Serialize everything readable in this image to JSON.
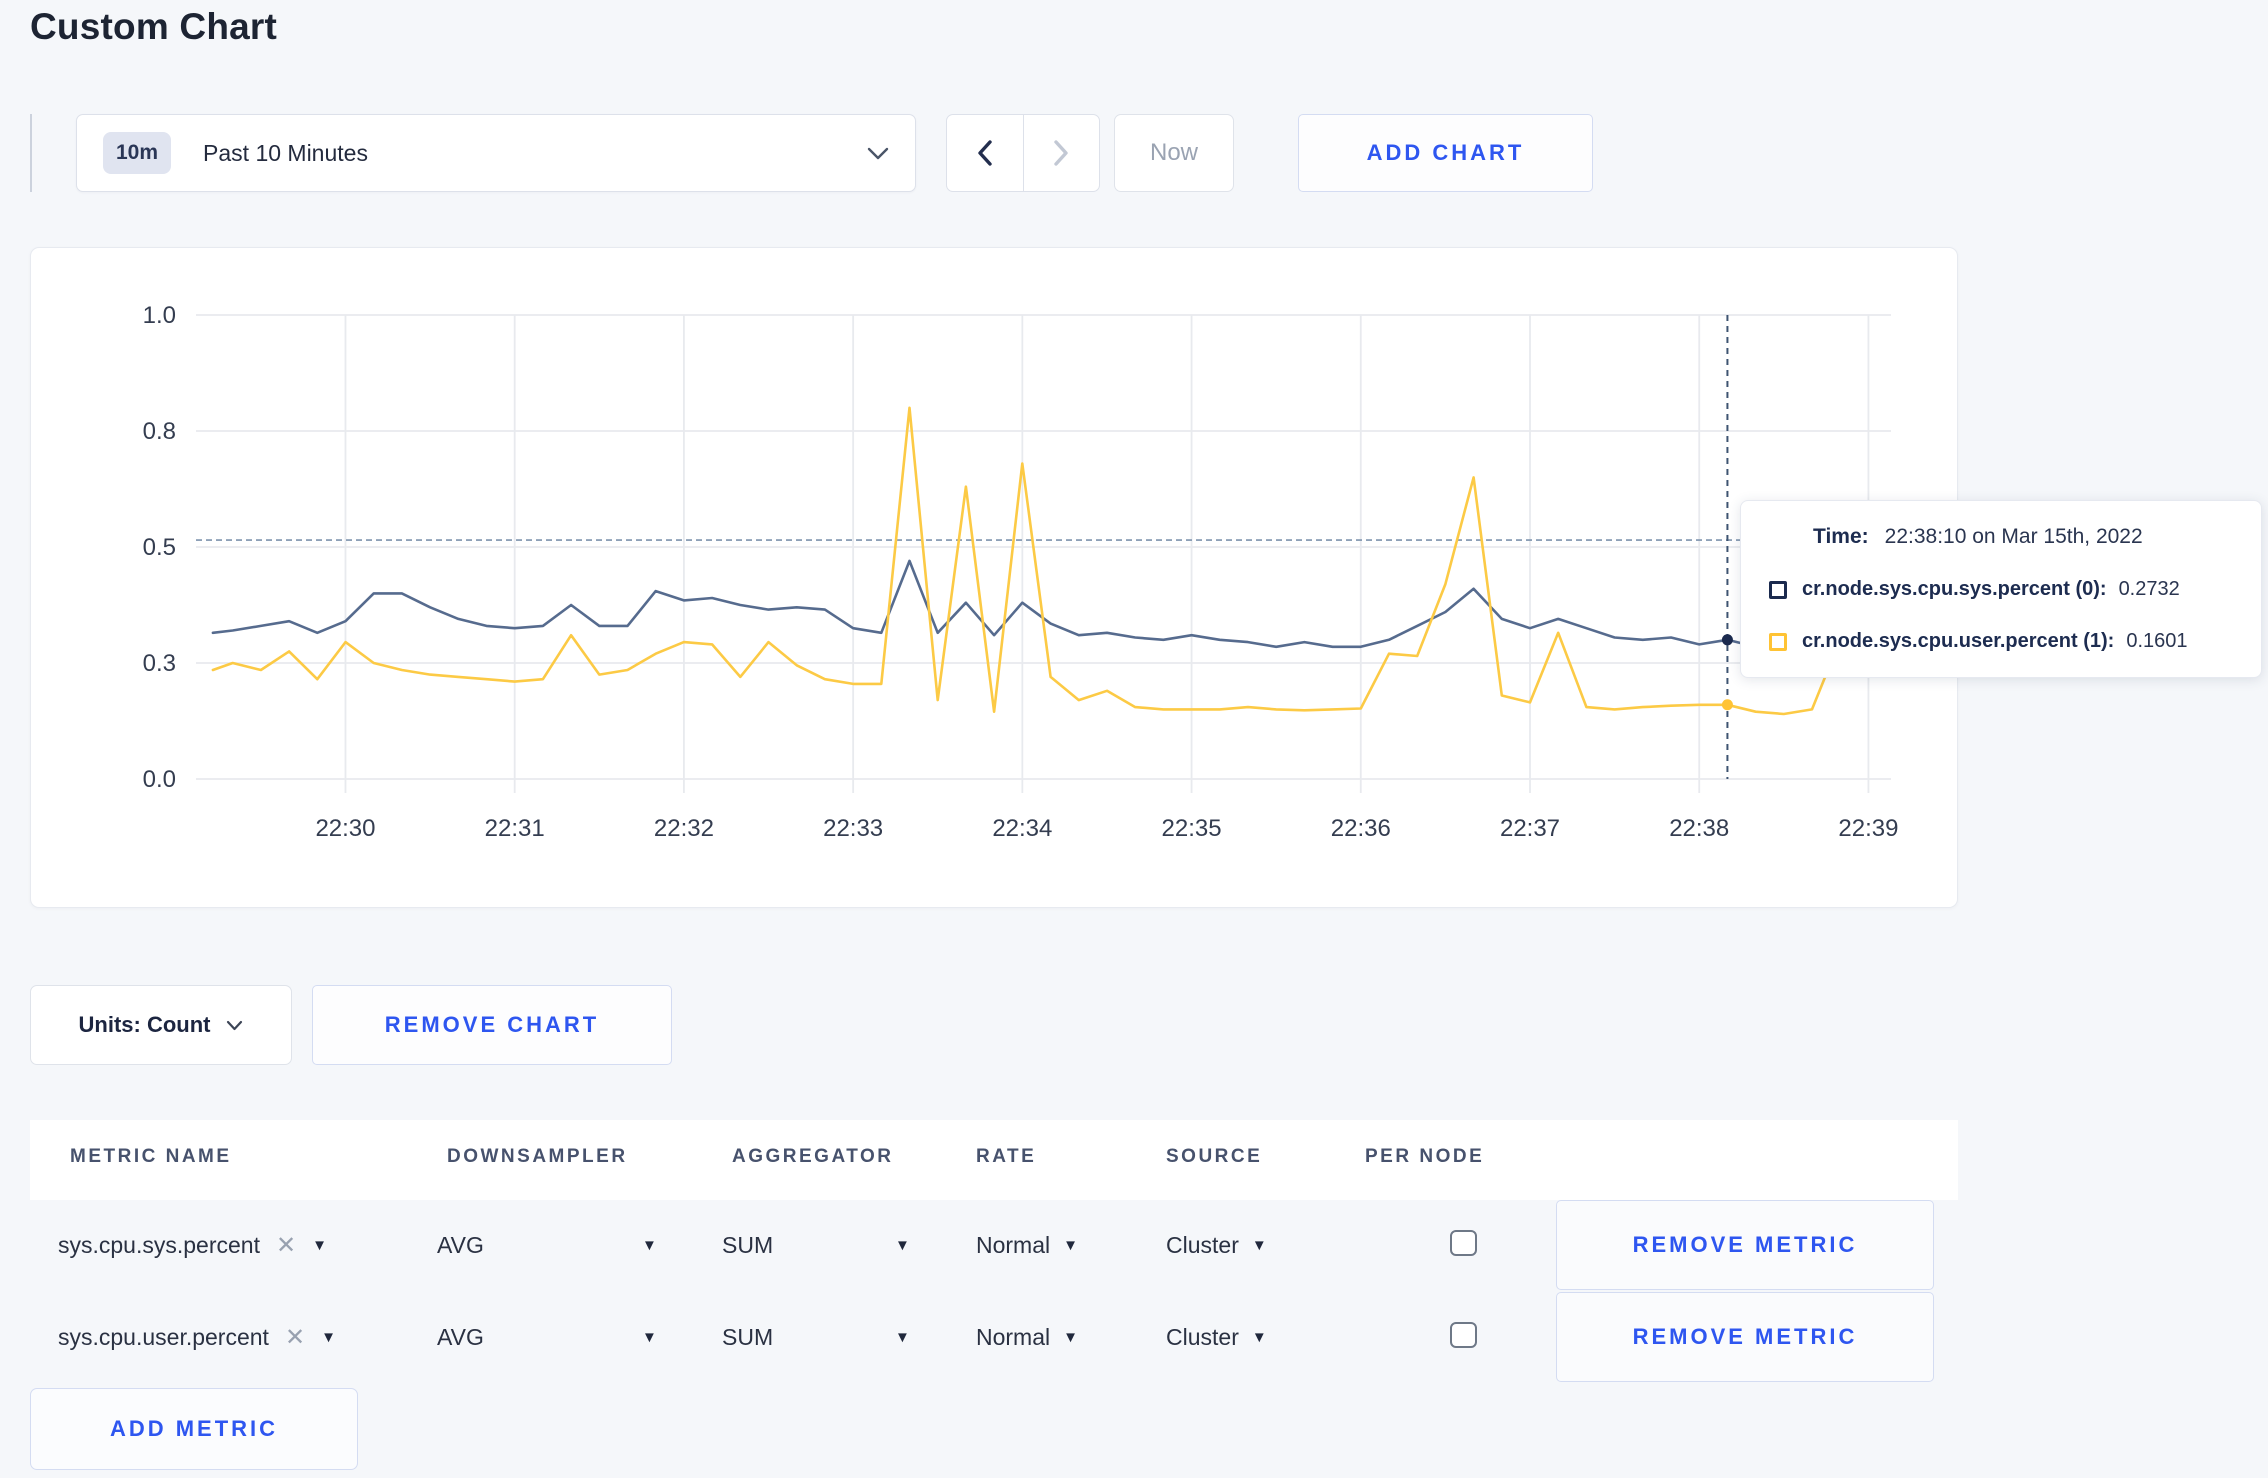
{
  "page": {
    "title": "Custom Chart"
  },
  "colors": {
    "accent_blue": "#2e56f0",
    "line_sys": "#566b8e",
    "line_user": "#fcca45",
    "swatch_sys": "#1b2a4e",
    "swatch_user": "#ffc334",
    "crosshair": "#3e5371",
    "hline": "#7d93ad",
    "grid": "#e8eaee",
    "tick_text": "#343d50"
  },
  "toolbar": {
    "time_badge": "10m",
    "time_label": "Past 10 Minutes",
    "now_label": "Now",
    "add_chart_label": "ADD CHART"
  },
  "chart_data": {
    "type": "line",
    "title": "",
    "xlabel": "",
    "ylabel": "",
    "x_unit": "seconds since 22:29:10 on Mar 15th, 2022",
    "x_domain": [
      -3,
      598
    ],
    "ylim": [
      0,
      1
    ],
    "grid": true,
    "legend_position": "none",
    "x": [
      3,
      10,
      20,
      30,
      40,
      50,
      60,
      70,
      80,
      90,
      100,
      110,
      120,
      130,
      140,
      150,
      160,
      170,
      180,
      190,
      200,
      210,
      220,
      230,
      240,
      250,
      260,
      270,
      280,
      290,
      300,
      310,
      320,
      330,
      340,
      350,
      360,
      370,
      380,
      390,
      400,
      410,
      420,
      430,
      440,
      450,
      460,
      470,
      480,
      490,
      500,
      510,
      520,
      530,
      540,
      550,
      560,
      570,
      580,
      590,
      596
    ],
    "series": [
      {
        "name": "cr.node.sys.cpu.sys.percent",
        "color": "#566b8e",
        "values": [
          0.315,
          0.32,
          0.33,
          0.34,
          0.315,
          0.34,
          0.4,
          0.4,
          0.37,
          0.345,
          0.33,
          0.325,
          0.33,
          0.375,
          0.33,
          0.33,
          0.405,
          0.385,
          0.39,
          0.375,
          0.365,
          0.37,
          0.365,
          0.325,
          0.315,
          0.47,
          0.315,
          0.38,
          0.31,
          0.38,
          0.335,
          0.31,
          0.315,
          0.305,
          0.3,
          0.31,
          0.3,
          0.295,
          0.285,
          0.295,
          0.285,
          0.285,
          0.3,
          0.33,
          0.36,
          0.41,
          0.345,
          0.325,
          0.345,
          0.325,
          0.305,
          0.3,
          0.305,
          0.29,
          0.3,
          0.285,
          0.3,
          0.315,
          0.295,
          0.3,
          0.3
        ]
      },
      {
        "name": "cr.node.sys.cpu.user.percent",
        "color": "#fcca45",
        "values": [
          0.235,
          0.25,
          0.235,
          0.275,
          0.215,
          0.295,
          0.25,
          0.235,
          0.225,
          0.22,
          0.215,
          0.21,
          0.215,
          0.31,
          0.225,
          0.235,
          0.27,
          0.295,
          0.29,
          0.22,
          0.295,
          0.245,
          0.215,
          0.205,
          0.205,
          0.8,
          0.17,
          0.63,
          0.145,
          0.68,
          0.22,
          0.17,
          0.19,
          0.155,
          0.15,
          0.15,
          0.15,
          0.155,
          0.15,
          0.148,
          0.15,
          0.152,
          0.27,
          0.265,
          0.42,
          0.65,
          0.18,
          0.165,
          0.315,
          0.155,
          0.15,
          0.155,
          0.158,
          0.16,
          0.16,
          0.145,
          0.14,
          0.15,
          0.3,
          0.27,
          0.26
        ]
      }
    ],
    "yticks": [
      [
        "0.0",
        0
      ],
      [
        "0.3",
        0.25
      ],
      [
        "0.5",
        0.5
      ],
      [
        "0.8",
        0.75
      ],
      [
        "1.0",
        1
      ]
    ],
    "xticks": [
      [
        "22:30",
        50
      ],
      [
        "22:31",
        110
      ],
      [
        "22:32",
        170
      ],
      [
        "22:33",
        230
      ],
      [
        "22:34",
        290
      ],
      [
        "22:35",
        350
      ],
      [
        "22:36",
        410
      ],
      [
        "22:37",
        470
      ],
      [
        "22:38",
        530
      ],
      [
        "22:39",
        590
      ]
    ],
    "crosshair": {
      "t": 540,
      "time": "22:38:10",
      "hline_v": 0.515,
      "points": [
        {
          "series": 0,
          "v": 0.3
        },
        {
          "series": 1,
          "v": 0.16
        }
      ]
    }
  },
  "tooltip": {
    "time_label": "Time:",
    "time_value": "22:38:10 on Mar 15th, 2022",
    "series": [
      {
        "label": "cr.node.sys.cpu.sys.percent (0):",
        "value": "0.2732",
        "color": "#1b2a4e"
      },
      {
        "label": "cr.node.sys.cpu.user.percent (1):",
        "value": "0.1601",
        "color": "#ffc334"
      }
    ]
  },
  "controls": {
    "units_label": "Units: Count",
    "remove_chart_label": "REMOVE CHART",
    "add_metric_label": "ADD METRIC",
    "remove_metric_label": "REMOVE METRIC"
  },
  "table": {
    "headers": [
      "METRIC NAME",
      "DOWNSAMPLER",
      "AGGREGATOR",
      "RATE",
      "SOURCE",
      "PER NODE"
    ],
    "rows": [
      {
        "metric": "sys.cpu.sys.percent",
        "downsampler": "AVG",
        "aggregator": "SUM",
        "rate": "Normal",
        "source": "Cluster",
        "per_node": false
      },
      {
        "metric": "sys.cpu.user.percent",
        "downsampler": "AVG",
        "aggregator": "SUM",
        "rate": "Normal",
        "source": "Cluster",
        "per_node": false
      }
    ]
  }
}
